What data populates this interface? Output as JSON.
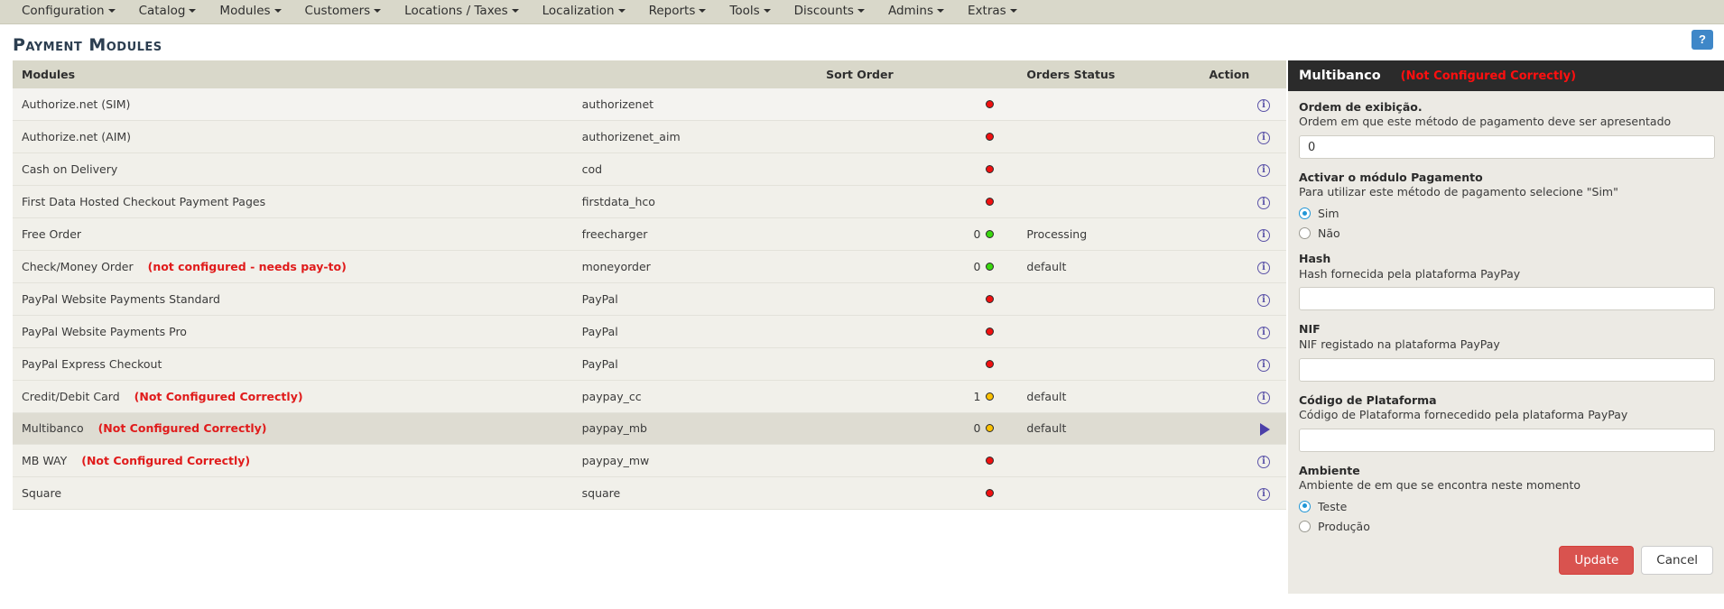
{
  "navbar": {
    "items": [
      {
        "label": "Configuration",
        "has_caret": true
      },
      {
        "label": "Catalog",
        "has_caret": true
      },
      {
        "label": "Modules",
        "has_caret": true
      },
      {
        "label": "Customers",
        "has_caret": true
      },
      {
        "label": "Locations / Taxes",
        "has_caret": true
      },
      {
        "label": "Localization",
        "has_caret": true
      },
      {
        "label": "Reports",
        "has_caret": true
      },
      {
        "label": "Tools",
        "has_caret": true
      },
      {
        "label": "Discounts",
        "has_caret": true
      },
      {
        "label": "Admins",
        "has_caret": true
      },
      {
        "label": "Extras",
        "has_caret": true
      }
    ]
  },
  "page": {
    "title": "Payment Modules",
    "help_label": "?"
  },
  "table": {
    "headers": {
      "modules": "Modules",
      "code": "",
      "sort_order": "Sort Order",
      "orders_status": "Orders Status",
      "action": "Action"
    },
    "rows": [
      {
        "name": "Authorize.net (SIM)",
        "warning": "",
        "code": "authorizenet",
        "sort": "",
        "dot": "red",
        "status": "",
        "action": "info-icon",
        "selected": false
      },
      {
        "name": "Authorize.net (AIM)",
        "warning": "",
        "code": "authorizenet_aim",
        "sort": "",
        "dot": "red",
        "status": "",
        "action": "info-icon",
        "selected": false
      },
      {
        "name": "Cash on Delivery",
        "warning": "",
        "code": "cod",
        "sort": "",
        "dot": "red",
        "status": "",
        "action": "info-icon",
        "selected": false
      },
      {
        "name": "First Data Hosted Checkout Payment Pages",
        "warning": "",
        "code": "firstdata_hco",
        "sort": "",
        "dot": "red",
        "status": "",
        "action": "info-icon",
        "selected": false
      },
      {
        "name": "Free Order",
        "warning": "",
        "code": "freecharger",
        "sort": "0",
        "dot": "green",
        "status": "Processing",
        "action": "info-icon",
        "selected": false
      },
      {
        "name": "Check/Money Order",
        "warning": "(not configured - needs pay-to)",
        "code": "moneyorder",
        "sort": "0",
        "dot": "green",
        "status": "default",
        "action": "info-icon",
        "selected": false
      },
      {
        "name": "PayPal Website Payments Standard",
        "warning": "",
        "code": "PayPal",
        "sort": "",
        "dot": "red",
        "status": "",
        "action": "info-icon",
        "selected": false
      },
      {
        "name": "PayPal Website Payments Pro",
        "warning": "",
        "code": "PayPal",
        "sort": "",
        "dot": "red",
        "status": "",
        "action": "info-icon",
        "selected": false
      },
      {
        "name": "PayPal Express Checkout",
        "warning": "",
        "code": "PayPal",
        "sort": "",
        "dot": "red",
        "status": "",
        "action": "info-icon",
        "selected": false
      },
      {
        "name": "Credit/Debit Card",
        "warning": "(Not Configured Correctly)",
        "code": "paypay_cc",
        "sort": "1",
        "dot": "yellow",
        "status": "default",
        "action": "info-icon",
        "selected": false
      },
      {
        "name": "Multibanco",
        "warning": "(Not Configured Correctly)",
        "code": "paypay_mb",
        "sort": "0",
        "dot": "yellow",
        "status": "default",
        "action": "play-icon",
        "selected": true
      },
      {
        "name": "MB WAY",
        "warning": "(Not Configured Correctly)",
        "code": "paypay_mw",
        "sort": "",
        "dot": "red",
        "status": "",
        "action": "info-icon",
        "selected": false
      },
      {
        "name": "Square",
        "warning": "",
        "code": "square",
        "sort": "",
        "dot": "red",
        "status": "",
        "action": "info-icon",
        "selected": false
      }
    ]
  },
  "panel": {
    "title": "Multibanco",
    "warning": "(Not Configured Correctly)",
    "fields": [
      {
        "label": "Ordem de exibição.",
        "desc": "Ordem em que este método de pagamento deve ser apresentado",
        "type": "text",
        "value": "0",
        "placeholder": ""
      },
      {
        "label": "Activar o módulo Pagamento",
        "desc": "Para utilizar este método de pagamento selecione \"Sim\"",
        "type": "radio",
        "options": [
          {
            "label": "Sim",
            "selected": true
          },
          {
            "label": "Não",
            "selected": false
          }
        ]
      },
      {
        "label": "Hash",
        "desc": "Hash fornecida pela plataforma PayPay",
        "type": "text",
        "value": "",
        "placeholder": ""
      },
      {
        "label": "NIF",
        "desc": "NIF registado na plataforma PayPay",
        "type": "text",
        "value": "",
        "placeholder": ""
      },
      {
        "label": "Código de Plataforma",
        "desc": "Código de Plataforma fornecedido pela plataforma PayPay",
        "type": "text",
        "value": "",
        "placeholder": ""
      },
      {
        "label": "Ambiente",
        "desc": "Ambiente de em que se encontra neste momento",
        "type": "radio",
        "options": [
          {
            "label": "Teste",
            "selected": true
          },
          {
            "label": "Produção",
            "selected": false
          }
        ]
      }
    ],
    "update_label": "Update",
    "cancel_label": "Cancel"
  },
  "colors": {
    "navbar_bg": "#d9d8ca",
    "panel_header_bg": "#2b2b2b",
    "warning_red": "#e01b1b",
    "accent_blue": "#3f87c8",
    "update_red": "#d9534f",
    "icon_purple": "#5b53a8"
  }
}
